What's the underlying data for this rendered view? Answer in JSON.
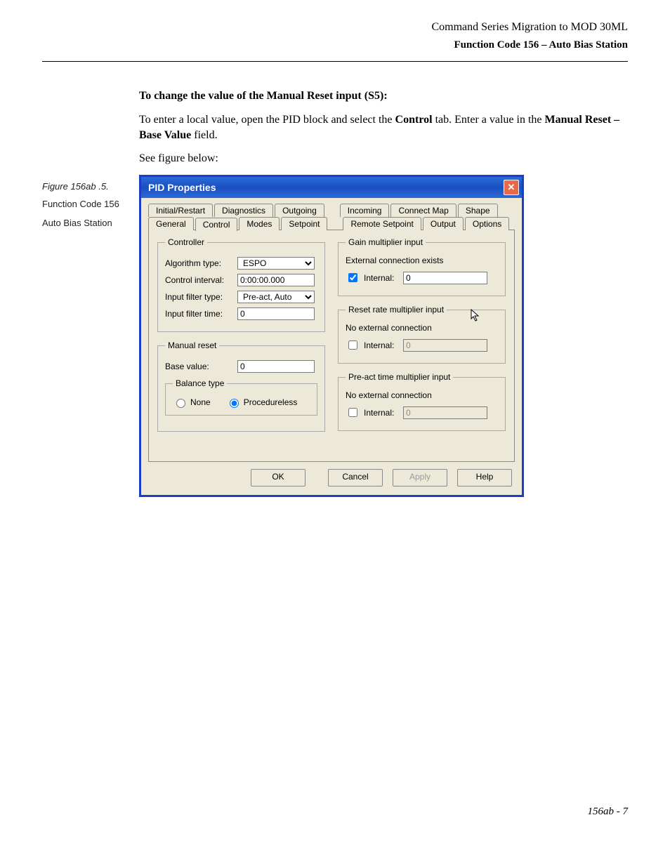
{
  "header": {
    "doc_title": "Command Series Migration to MOD 30ML",
    "section": "Function Code 156 – Auto Bias Station"
  },
  "sidebar": {
    "figure_label": "Figure 156ab .5.",
    "line1": "Function Code 156",
    "line2": "Auto Bias Station"
  },
  "instructions": {
    "title": "To change the value of the Manual Reset input (S5):",
    "body_pre": "To enter a local value, open the PID block and select the ",
    "body_bold1": "Control",
    "body_mid": " tab. Enter a value in the ",
    "body_bold2": "Manual Reset – Base Value",
    "body_post": " field.",
    "see": "See figure below:"
  },
  "dialog": {
    "title": "PID Properties",
    "close_glyph": "✕",
    "tabs_row1": [
      "Initial/Restart",
      "Diagnostics",
      "Outgoing",
      "Incoming",
      "Connect Map",
      "Shape"
    ],
    "tabs_row2": [
      "General",
      "Control",
      "Modes",
      "Setpoint",
      "Remote Setpoint",
      "Output",
      "Options"
    ],
    "active_tab": "Control",
    "controller": {
      "legend": "Controller",
      "algo_label": "Algorithm type:",
      "algo_value": "ESPO",
      "ctrl_int_label": "Control interval:",
      "ctrl_int_value": "0:00:00.000",
      "filter_type_label": "Input filter type:",
      "filter_type_value": "Pre-act, Auto",
      "filter_time_label": "Input filter time:",
      "filter_time_value": "0"
    },
    "manual_reset": {
      "legend": "Manual reset",
      "base_label": "Base value:",
      "base_value": "0",
      "balance_legend": "Balance type",
      "opt_none": "None",
      "opt_proc": "Procedureless",
      "selected": "Procedureless"
    },
    "gain": {
      "legend": "Gain multiplier input",
      "status": "External connection exists",
      "internal_label": "Internal:",
      "internal_checked": true,
      "internal_value": "0"
    },
    "reset_rate": {
      "legend": "Reset rate multiplier input",
      "status": "No external connection",
      "internal_label": "Internal:",
      "internal_checked": false,
      "internal_value": "0"
    },
    "preact": {
      "legend": "Pre-act time multiplier input",
      "status": "No external connection",
      "internal_label": "Internal:",
      "internal_checked": false,
      "internal_value": "0"
    },
    "buttons": {
      "ok": "OK",
      "cancel": "Cancel",
      "apply": "Apply",
      "help": "Help"
    }
  },
  "footer": {
    "page": "156ab - 7"
  }
}
